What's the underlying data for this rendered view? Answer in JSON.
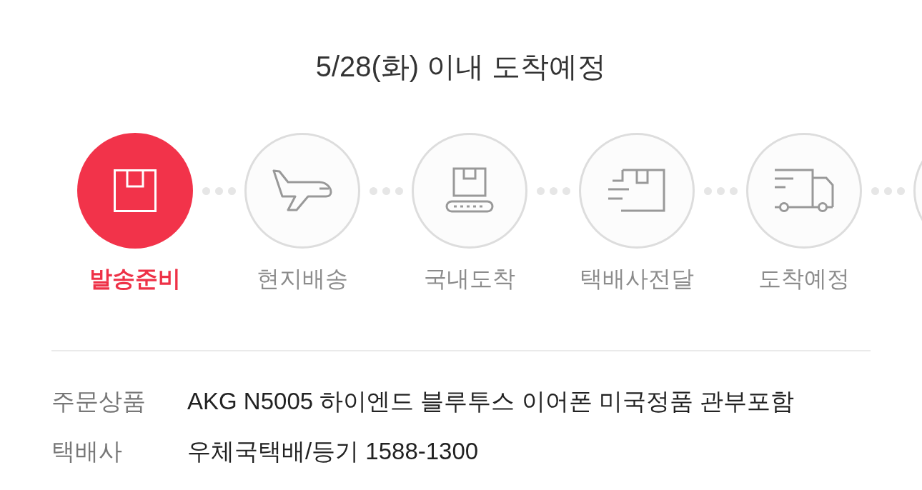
{
  "delivery_estimate": "5/28(화) 이내 도착예정",
  "steps": [
    {
      "label": "발송준비",
      "selected": true
    },
    {
      "label": "현지배송",
      "selected": false
    },
    {
      "label": "국내도착",
      "selected": false
    },
    {
      "label": "택배사전달",
      "selected": false
    },
    {
      "label": "도착예정",
      "selected": false
    },
    {
      "selected": false
    }
  ],
  "order_info": [
    {
      "label": "주문상품",
      "value": "AKG N5005 하이엔드 블루투스 이어폰 미국정품 관부포함"
    },
    {
      "label": "택배사",
      "value": "우체국택배/등기 1588-1300"
    }
  ]
}
